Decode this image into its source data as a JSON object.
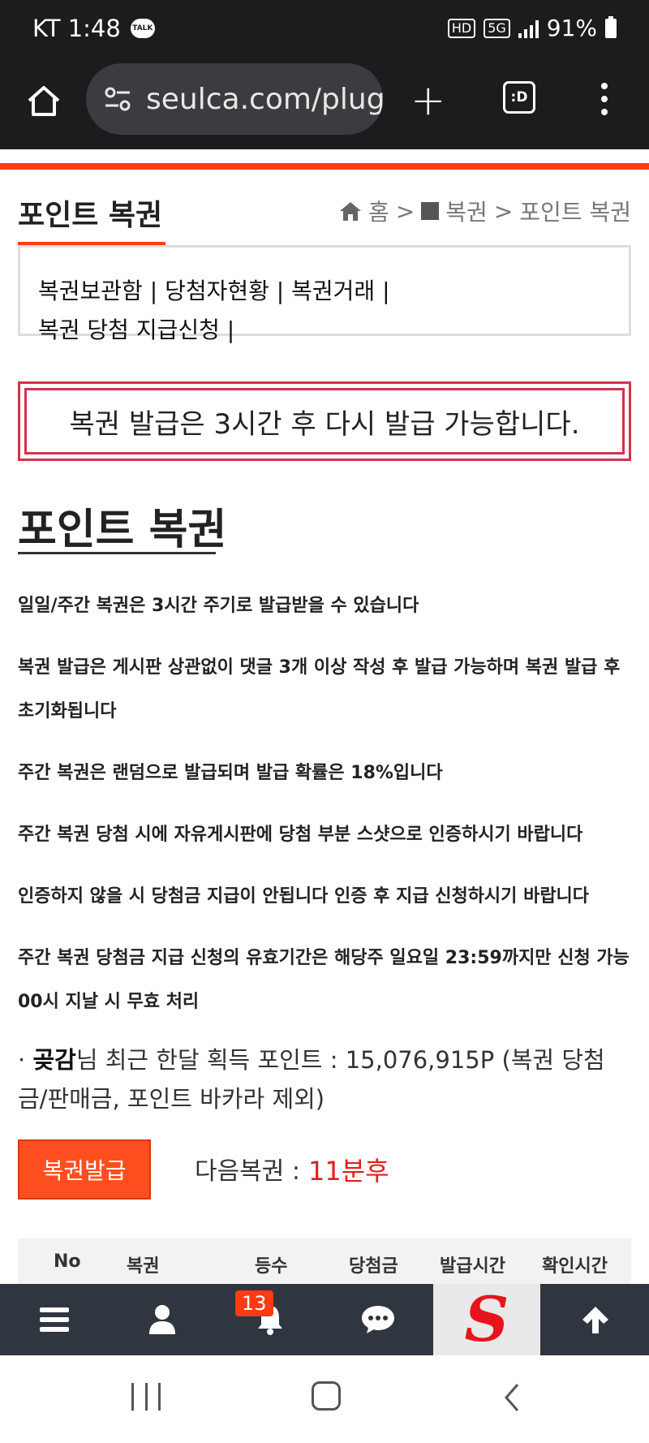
{
  "status_bar": {
    "carrier_time": "KT 1:48",
    "talk_icon_text": "TALK",
    "hd_label": "HD",
    "network_label": "5G",
    "battery": "91%"
  },
  "browser": {
    "url": "seulca.com/plug",
    "tabs_label": ":D"
  },
  "header": {
    "title": "포인트 복권",
    "breadcrumb": {
      "home": "홈",
      "sep1": ">",
      "category": "복권",
      "sep2": ">",
      "current": "포인트 복권"
    }
  },
  "sub_nav": {
    "items": [
      "복권보관함",
      "당첨자현황",
      "복권거래",
      "복권 당첨 지급신청"
    ],
    "separator": "|"
  },
  "notice": "복권 발급은 3시간 후 다시 발급 가능합니다.",
  "section_title": "포인트 복권",
  "rules": [
    "일일/주간 복권은 3시간 주기로 발급받을 수 있습니다",
    "복권 발급은 게시판 상관없이 댓글 3개 이상 작성 후 발급 가능하며 복권 발급 후 초기화됩니다",
    "주간 복권은 랜덤으로 발급되며 발급 확률은 18%입니다",
    "주간 복권 당첨 시에 자유게시판에 당첨 부분 스샷으로 인증하시기 바랍니다",
    "인증하지 않을 시 당첨금 지급이 안됩니다 인증 후 지급 신청하시기 바랍니다",
    "주간 복권 당첨금 지급 신청의 유효기간은 해당주 일요일 23:59까지만 신청 가능 00시 지날 시 무효 처리"
  ],
  "points": {
    "bullet": "·",
    "user": "곶감",
    "text": "님 최근 한달 획득 포인트 : 15,076,915P (복권 당첨금/판매금, 포인트 바카라 제외)"
  },
  "issue_button": "복권발급",
  "next_lottery": {
    "label": "다음복권 :",
    "value": "11분후"
  },
  "table": {
    "headers": [
      "No",
      "복권",
      "등수",
      "당첨금",
      "발급시간",
      "확인시간"
    ]
  },
  "bottom_nav": {
    "notification_count": "13",
    "logo_letter": "S"
  },
  "colors": {
    "accent": "#ff3b12",
    "notice_border": "#d2334b",
    "next_value": "#e61c1c",
    "nav_bg": "#2f3640"
  }
}
